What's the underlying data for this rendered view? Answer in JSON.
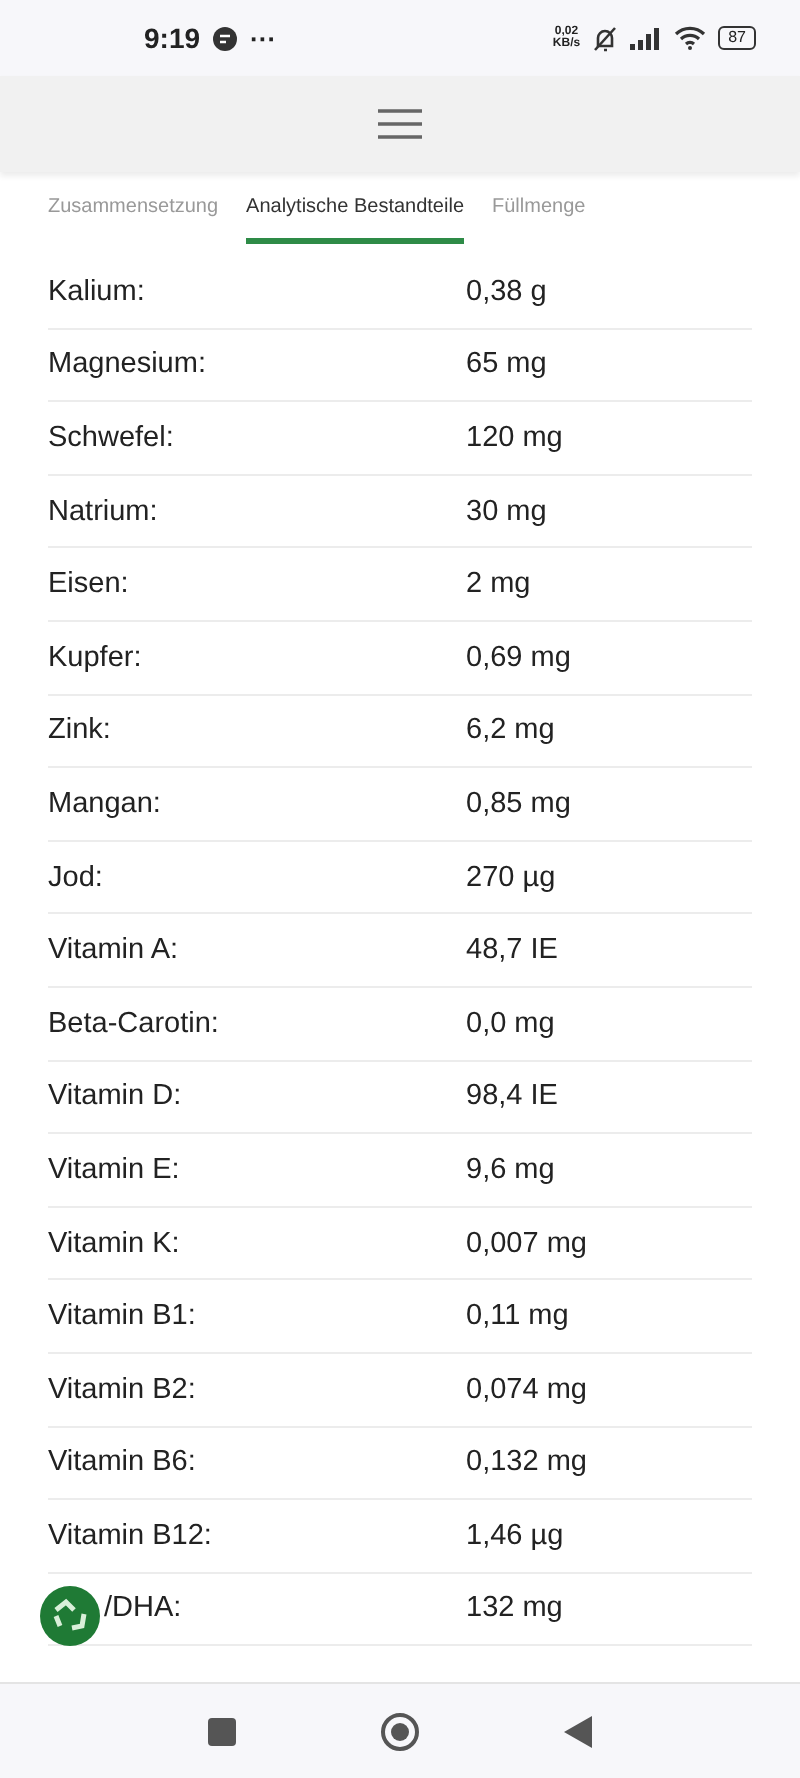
{
  "status_bar": {
    "time": "9:19",
    "dots": "···",
    "speed": "0,02\nKB/s",
    "battery": "87"
  },
  "tabs": [
    {
      "label": "Zusammensetzung",
      "selected": false
    },
    {
      "label": "Analytische Bestandteile",
      "selected": true
    },
    {
      "label": "Füllmenge",
      "selected": false
    }
  ],
  "rows": [
    {
      "name": "Kalium:",
      "value": "0,38 g"
    },
    {
      "name": "Magnesium:",
      "value": "65 mg"
    },
    {
      "name": "Schwefel:",
      "value": "120 mg"
    },
    {
      "name": "Natrium:",
      "value": "30 mg"
    },
    {
      "name": "Eisen:",
      "value": "2 mg"
    },
    {
      "name": "Kupfer:",
      "value": "0,69 mg"
    },
    {
      "name": "Zink:",
      "value": "6,2 mg"
    },
    {
      "name": "Mangan:",
      "value": "0,85 mg"
    },
    {
      "name": "Jod:",
      "value": "270 µg"
    },
    {
      "name": "Vitamin A:",
      "value": "48,7 IE"
    },
    {
      "name": "Beta-Carotin:",
      "value": "0,0 mg"
    },
    {
      "name": "Vitamin D:",
      "value": "98,4 IE"
    },
    {
      "name": "Vitamin E:",
      "value": "9,6 mg"
    },
    {
      "name": "Vitamin K:",
      "value": "0,007 mg"
    },
    {
      "name": "Vitamin B1:",
      "value": "0,11 mg"
    },
    {
      "name": "Vitamin B2:",
      "value": "0,074 mg"
    },
    {
      "name": "Vitamin B6:",
      "value": "0,132 mg"
    },
    {
      "name": "Vitamin B12:",
      "value": "1,46 µg"
    },
    {
      "name": "/DHA:",
      "value": "132 mg",
      "kind": "covered"
    }
  ]
}
